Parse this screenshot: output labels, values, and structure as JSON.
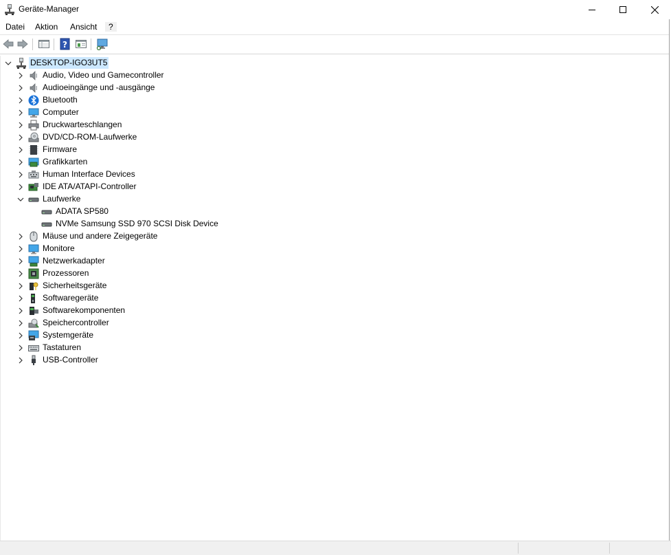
{
  "window": {
    "title": "Geräte-Manager",
    "controls": [
      "minimize",
      "maximize",
      "close"
    ]
  },
  "menu": {
    "items": [
      "Datei",
      "Aktion",
      "Ansicht",
      "?"
    ]
  },
  "toolbar": {
    "buttons": [
      "back-icon",
      "forward-icon",
      "properties-grid-icon",
      "help-icon",
      "details-view-icon",
      "monitor-scan-icon"
    ]
  },
  "tree": {
    "root": "DESKTOP-IGO3UT5",
    "nodes": [
      {
        "label": "Audio, Video und Gamecontroller",
        "icon": "speaker-icon",
        "expanded": false
      },
      {
        "label": "Audioeingänge und -ausgänge",
        "icon": "speaker-icon",
        "expanded": false
      },
      {
        "label": "Bluetooth",
        "icon": "bluetooth-icon",
        "expanded": false
      },
      {
        "label": "Computer",
        "icon": "computer-icon",
        "expanded": false
      },
      {
        "label": "Druckwarteschlangen",
        "icon": "printer-icon",
        "expanded": false
      },
      {
        "label": "DVD/CD-ROM-Laufwerke",
        "icon": "dvd-drive-icon",
        "expanded": false
      },
      {
        "label": "Firmware",
        "icon": "firmware-icon",
        "expanded": false
      },
      {
        "label": "Grafikkarten",
        "icon": "display-adapter-icon",
        "expanded": false
      },
      {
        "label": "Human Interface Devices",
        "icon": "hid-icon",
        "expanded": false
      },
      {
        "label": "IDE ATA/ATAPI-Controller",
        "icon": "ide-controller-icon",
        "expanded": false
      },
      {
        "label": "Laufwerke",
        "icon": "disk-drive-icon",
        "expanded": true,
        "children": [
          {
            "label": "ADATA SP580",
            "icon": "disk-drive-icon"
          },
          {
            "label": "NVMe Samsung SSD 970 SCSI Disk Device",
            "icon": "disk-drive-icon"
          }
        ]
      },
      {
        "label": "Mäuse und andere Zeigegeräte",
        "icon": "mouse-icon",
        "expanded": false
      },
      {
        "label": "Monitore",
        "icon": "monitor-icon",
        "expanded": false
      },
      {
        "label": "Netzwerkadapter",
        "icon": "network-adapter-icon",
        "expanded": false
      },
      {
        "label": "Prozessoren",
        "icon": "processor-icon",
        "expanded": false
      },
      {
        "label": "Sicherheitsgeräte",
        "icon": "security-device-icon",
        "expanded": false
      },
      {
        "label": "Softwaregeräte",
        "icon": "software-device-icon",
        "expanded": false
      },
      {
        "label": "Softwarekomponenten",
        "icon": "software-component-icon",
        "expanded": false
      },
      {
        "label": "Speichercontroller",
        "icon": "storage-controller-icon",
        "expanded": false
      },
      {
        "label": "Systemgeräte",
        "icon": "system-device-icon",
        "expanded": false
      },
      {
        "label": "Tastaturen",
        "icon": "keyboard-icon",
        "expanded": false
      },
      {
        "label": "USB-Controller",
        "icon": "usb-icon",
        "expanded": false
      }
    ]
  },
  "colors": {
    "selection": "#cce8ff",
    "accent": "#0078d7"
  }
}
